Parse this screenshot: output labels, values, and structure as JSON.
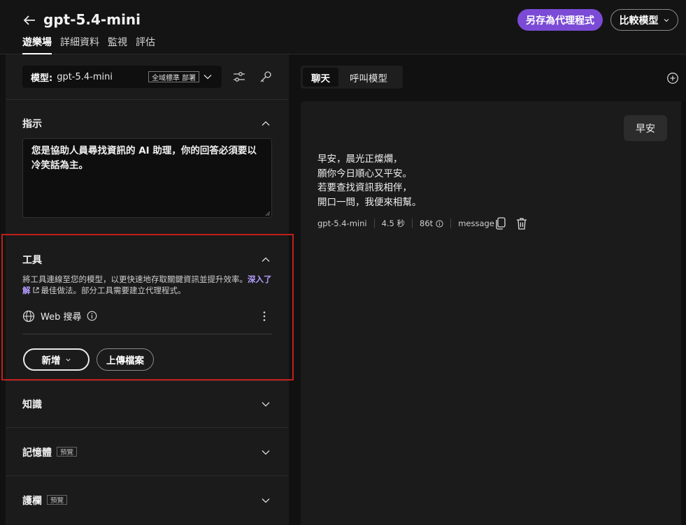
{
  "header": {
    "title": "gpt-5.4-mini",
    "tabs": [
      {
        "label": "遊樂場",
        "active": true
      },
      {
        "label": "詳細資料",
        "active": false
      },
      {
        "label": "監視",
        "active": false
      },
      {
        "label": "評估",
        "active": false
      }
    ],
    "save_agent_label": "另存為代理程式",
    "compare_label": "比較模型"
  },
  "model_bar": {
    "label": "模型:",
    "value": "gpt-5.4-mini",
    "deployment_badge": "全域標準 部署"
  },
  "instructions": {
    "title": "指示",
    "text_line1": "您是協助人員尋找資訊的 AI 助理，你的回答必須要以",
    "text_line2": "冷笑話為主。"
  },
  "tools": {
    "title": "工具",
    "desc_prefix": "將工具連線至您的模型，以更快速地存取關鍵資訊並提升效率。",
    "learn_more": "深入了解",
    "desc_suffix": "最佳做法。部分工具需要建立代理程式。",
    "web_search_label": "Web 搜尋",
    "add_label": "新增",
    "upload_label": "上傳檔案"
  },
  "knowledge": {
    "title": "知識"
  },
  "memory": {
    "title": "記憶體",
    "badge": "預覽"
  },
  "guardrails": {
    "title": "護欄",
    "badge": "預覽"
  },
  "chat": {
    "tabs": [
      {
        "label": "聊天",
        "active": true
      },
      {
        "label": "呼叫模型",
        "active": false
      }
    ],
    "user_message": "早安",
    "assistant_lines": [
      "早安，晨光正燦爛，",
      "願你今日順心又平安。",
      "若要查找資訊我相伴，",
      "開口一問，我便來相幫。"
    ],
    "meta": {
      "model": "gpt-5.4-mini",
      "time": "4.5 秒",
      "tokens": "86t",
      "type": "message"
    }
  },
  "colors": {
    "accent": "#7b4bd6",
    "highlight_border": "#c0201c",
    "link": "#b49cff"
  }
}
